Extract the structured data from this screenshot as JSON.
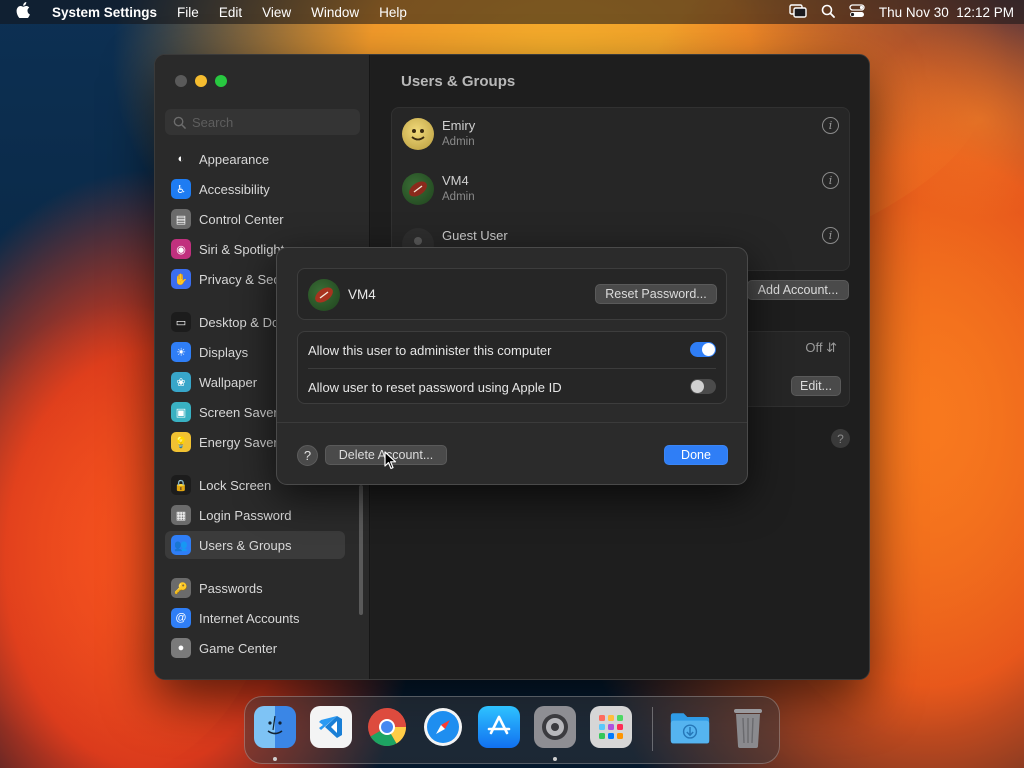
{
  "menubar": {
    "app_name": "System Settings",
    "menus": [
      "File",
      "Edit",
      "View",
      "Window",
      "Help"
    ],
    "datetime": "Thu Nov 30  12:12 PM"
  },
  "sidebar": {
    "search_placeholder": "Search",
    "items": [
      {
        "label": "Appearance",
        "icon": "appearance-icon",
        "color": "#2a2a2a"
      },
      {
        "label": "Accessibility",
        "icon": "accessibility-icon",
        "color": "#1e7cf2"
      },
      {
        "label": "Control Center",
        "icon": "control-center-icon",
        "color": "#6b6b6b"
      },
      {
        "label": "Siri & Spotlight",
        "icon": "siri-icon",
        "color": "#c1307e"
      },
      {
        "label": "Privacy & Security",
        "icon": "privacy-hand-icon",
        "color": "#3b6ef0"
      },
      {
        "label": "Desktop & Dock",
        "icon": "desktop-dock-icon",
        "color": "#1c1c1c"
      },
      {
        "label": "Displays",
        "icon": "displays-icon",
        "color": "#2f7ef6"
      },
      {
        "label": "Wallpaper",
        "icon": "wallpaper-icon",
        "color": "#38a6c9"
      },
      {
        "label": "Screen Saver",
        "icon": "screen-saver-icon",
        "color": "#39b1c2"
      },
      {
        "label": "Energy Saver",
        "icon": "energy-saver-icon",
        "color": "#f1c232"
      },
      {
        "label": "Lock Screen",
        "icon": "lock-screen-icon",
        "color": "#1c1c1c"
      },
      {
        "label": "Login Password",
        "icon": "login-password-icon",
        "color": "#6b6b6b"
      },
      {
        "label": "Users & Groups",
        "icon": "users-groups-icon",
        "color": "#2f7ef6"
      },
      {
        "label": "Passwords",
        "icon": "passwords-key-icon",
        "color": "#6b6b6b"
      },
      {
        "label": "Internet Accounts",
        "icon": "internet-accounts-icon",
        "color": "#2f7ef6"
      },
      {
        "label": "Game Center",
        "icon": "game-center-icon",
        "color": "#7a7a7a"
      }
    ]
  },
  "main": {
    "title": "Users & Groups",
    "users": [
      {
        "name": "Emiry",
        "role": "Admin"
      },
      {
        "name": "VM4",
        "role": "Admin"
      },
      {
        "name": "Guest User",
        "role": ""
      }
    ],
    "add_account_label": "Add Account...",
    "auto_login_value": "Off",
    "edit_label": "Edit..."
  },
  "dialog": {
    "user_name": "VM4",
    "reset_password_label": "Reset Password...",
    "options": [
      {
        "label": "Allow this user to administer this computer",
        "on": true
      },
      {
        "label": "Allow user to reset password using Apple ID",
        "on": false
      }
    ],
    "help_label": "?",
    "delete_label": "Delete Account...",
    "done_label": "Done"
  },
  "dock": {
    "apps": [
      "finder-icon",
      "vscode-icon",
      "chrome-icon",
      "safari-icon",
      "app-store-icon",
      "system-settings-icon",
      "launchpad-icon",
      "downloads-folder-icon",
      "trash-icon"
    ]
  }
}
